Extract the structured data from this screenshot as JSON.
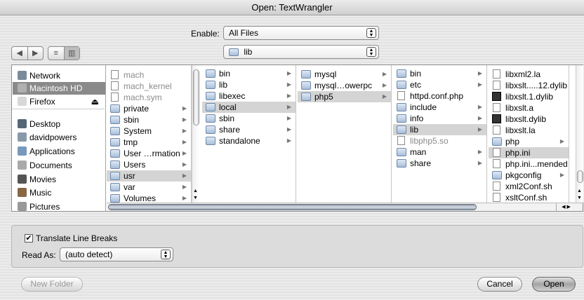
{
  "window": {
    "title": "Open: TextWrangler"
  },
  "enable": {
    "label": "Enable:",
    "value": "All Files"
  },
  "location": {
    "value": "lib"
  },
  "nav": {
    "back": "◀",
    "forward": "▶",
    "list_view": "≡",
    "column_view": "▥"
  },
  "sidebar": {
    "items": [
      {
        "label": "Network",
        "icon": "globe-icon"
      },
      {
        "label": "Macintosh HD",
        "icon": "hard-drive-icon"
      },
      {
        "label": "Firefox",
        "icon": "disk-icon"
      },
      {
        "label": "Desktop",
        "icon": "desktop-icon"
      },
      {
        "label": "davidpowers",
        "icon": "home-icon"
      },
      {
        "label": "Applications",
        "icon": "applications-icon"
      },
      {
        "label": "Documents",
        "icon": "documents-icon"
      },
      {
        "label": "Movies",
        "icon": "movies-icon"
      },
      {
        "label": "Music",
        "icon": "music-icon"
      },
      {
        "label": "Pictures",
        "icon": "pictures-icon"
      }
    ],
    "eject": "⏏"
  },
  "columns": [
    {
      "items": [
        {
          "name": "mach",
          "type": "doc",
          "dim": true
        },
        {
          "name": "mach_kernel",
          "type": "doc",
          "dim": true
        },
        {
          "name": "mach.sym",
          "type": "doc",
          "dim": true
        },
        {
          "name": "private",
          "type": "folder",
          "arrow": "▶"
        },
        {
          "name": "sbin",
          "type": "folder",
          "arrow": "▶"
        },
        {
          "name": "System",
          "type": "folder",
          "arrow": "▶"
        },
        {
          "name": "tmp",
          "type": "folder",
          "arrow": "▶"
        },
        {
          "name": "User …rmation",
          "type": "folder",
          "arrow": "▶"
        },
        {
          "name": "Users",
          "type": "folder",
          "arrow": "▶"
        },
        {
          "name": "usr",
          "type": "folder",
          "arrow": "▶",
          "selected": true
        },
        {
          "name": "var",
          "type": "folder",
          "arrow": "▶"
        },
        {
          "name": "Volumes",
          "type": "folder",
          "arrow": "▶"
        }
      ]
    },
    {
      "items": [
        {
          "name": "bin",
          "type": "folder",
          "arrow": "▶"
        },
        {
          "name": "lib",
          "type": "folder",
          "arrow": "▶"
        },
        {
          "name": "libexec",
          "type": "folder",
          "arrow": "▶"
        },
        {
          "name": "local",
          "type": "folder",
          "arrow": "▶",
          "selected": true
        },
        {
          "name": "sbin",
          "type": "folder",
          "arrow": "▶"
        },
        {
          "name": "share",
          "type": "folder",
          "arrow": "▶"
        },
        {
          "name": "standalone",
          "type": "folder",
          "arrow": "▶"
        }
      ]
    },
    {
      "items": [
        {
          "name": "mysql",
          "type": "folder",
          "arrow": "▶"
        },
        {
          "name": "mysql…owerpc",
          "type": "folder",
          "arrow": "▶"
        },
        {
          "name": "php5",
          "type": "folder",
          "arrow": "▶",
          "selected": true
        }
      ]
    },
    {
      "items": [
        {
          "name": "bin",
          "type": "folder",
          "arrow": "▶"
        },
        {
          "name": "etc",
          "type": "folder",
          "arrow": "▶"
        },
        {
          "name": "httpd.conf.php",
          "type": "doc"
        },
        {
          "name": "include",
          "type": "folder",
          "arrow": "▶"
        },
        {
          "name": "info",
          "type": "folder",
          "arrow": "▶"
        },
        {
          "name": "lib",
          "type": "folder",
          "arrow": "▶",
          "selected": true
        },
        {
          "name": "libphp5.so",
          "type": "doc",
          "dim": true
        },
        {
          "name": "man",
          "type": "folder",
          "arrow": "▶"
        },
        {
          "name": "share",
          "type": "folder",
          "arrow": "▶"
        }
      ]
    },
    {
      "items": [
        {
          "name": "libxml2.la",
          "type": "doc"
        },
        {
          "name": "libxslt.....12.dylib",
          "type": "doc"
        },
        {
          "name": "libxslt.1.dylib",
          "type": "exe"
        },
        {
          "name": "libxslt.a",
          "type": "doc"
        },
        {
          "name": "libxslt.dylib",
          "type": "exe"
        },
        {
          "name": "libxslt.la",
          "type": "doc"
        },
        {
          "name": "php",
          "type": "folder",
          "arrow": "▶"
        },
        {
          "name": "php.ini",
          "type": "doc",
          "selected": true
        },
        {
          "name": "php.ini...mended",
          "type": "doc"
        },
        {
          "name": "pkgconfig",
          "type": "folder",
          "arrow": "▶"
        },
        {
          "name": "xml2Conf.sh",
          "type": "doc"
        },
        {
          "name": "xsltConf.sh",
          "type": "doc"
        }
      ]
    }
  ],
  "options": {
    "translate_line_breaks": {
      "label": "Translate Line Breaks",
      "checked": true,
      "mark": "✔"
    },
    "read_as": {
      "label": "Read As:",
      "value": "(auto detect)"
    }
  },
  "buttons": {
    "new_folder": "New Folder",
    "cancel": "Cancel",
    "open": "Open"
  },
  "scroll": {
    "left": "◀",
    "right": "▶",
    "up": "▲",
    "down": "▼"
  },
  "popup_arrows": "▲\n▼"
}
